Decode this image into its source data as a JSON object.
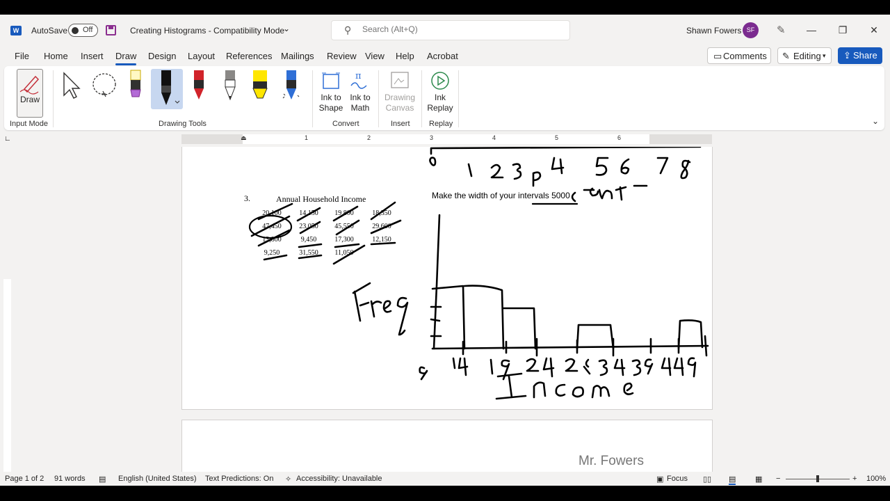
{
  "titlebar": {
    "autosave_label": "AutoSave",
    "autosave_state": "Off",
    "doc_title": "Creating Histograms  -  Compatibility Mode",
    "search_placeholder": "Search (Alt+Q)",
    "user_name": "Shawn Fowers",
    "user_initials": "SF"
  },
  "menu": {
    "tabs": [
      "File",
      "Home",
      "Insert",
      "Draw",
      "Design",
      "Layout",
      "References",
      "Mailings",
      "Review",
      "View",
      "Help",
      "Acrobat"
    ],
    "active_tab": "Draw",
    "comments": "Comments",
    "editing": "Editing",
    "share": "Share"
  },
  "ribbon": {
    "draw_label": "Draw",
    "ink_to_shape": [
      "Ink to",
      "Shape"
    ],
    "ink_to_math": [
      "Ink to",
      "Math"
    ],
    "drawing_canvas": [
      "Drawing",
      "Canvas"
    ],
    "ink_replay": [
      "Ink",
      "Replay"
    ],
    "groups": [
      "Input Mode",
      "Drawing Tools",
      "Convert",
      "Insert",
      "Replay"
    ]
  },
  "ruler": {
    "numbers": [
      "1",
      "1",
      "2",
      "3",
      "4",
      "5",
      "6"
    ]
  },
  "document": {
    "question_number": "3.",
    "table_title": "Annual Household Income",
    "table": [
      [
        "20,100",
        "14,150",
        "19,800",
        "18,350"
      ],
      [
        "47,450",
        "23,050",
        "45,550",
        "29,600"
      ],
      [
        "13,800",
        "9,450",
        "17,300",
        "12,150"
      ],
      [
        "9,250",
        "31,550",
        "11,050",
        ""
      ]
    ],
    "prompt": "Make the width of your intervals 5000",
    "footer_name": "Mr. Fowers"
  },
  "statusbar": {
    "page": "Page 1 of 2",
    "words": "91 words",
    "language": "English (United States)",
    "predictions": "Text Predictions: On",
    "accessibility": "Accessibility: Unavailable",
    "focus": "Focus",
    "zoom": "100%"
  },
  "colors": {
    "accent": "#185abd",
    "avatar": "#7b2b8f",
    "ink": "#000000"
  }
}
